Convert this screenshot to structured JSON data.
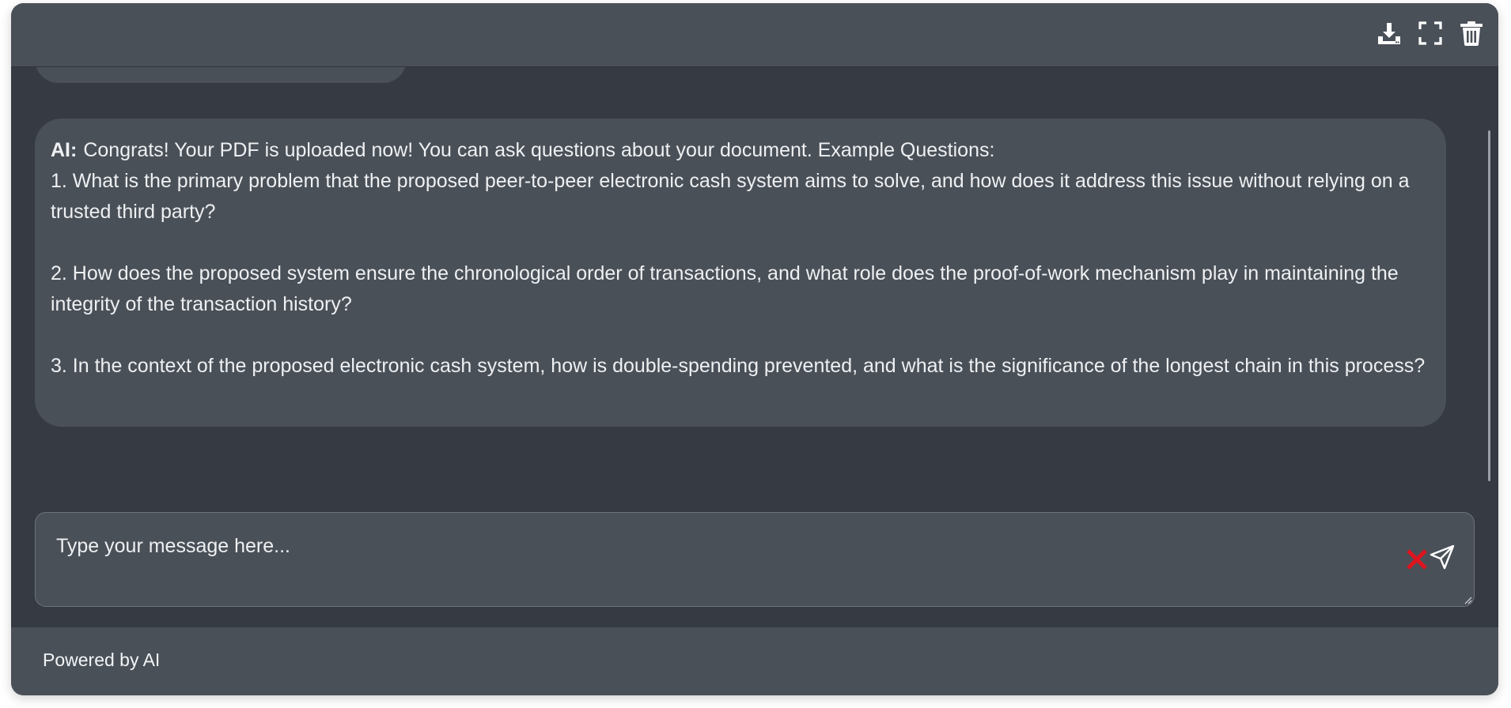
{
  "header": {
    "actions": [
      {
        "icon": "download-icon",
        "label": "Download"
      },
      {
        "icon": "fullscreen-icon",
        "label": "Fullscreen"
      },
      {
        "icon": "trash-icon",
        "label": "Delete"
      }
    ]
  },
  "chat": {
    "ai_message": {
      "sender_label": "AI:",
      "intro": "Congrats! Your PDF is uploaded now! You can ask questions about your document. Example Questions:",
      "questions": [
        "1. What is the primary problem that the proposed peer-to-peer electronic cash system aims to solve, and how does it address this issue without relying on a trusted third party?",
        "2. How does the proposed system ensure the chronological order of transactions, and what role does the proof-of-work mechanism play in maintaining the integrity of the transaction history?",
        "3. In the context of the proposed electronic cash system, how is double-spending prevented, and what is the significance of the longest chain in this process?"
      ]
    }
  },
  "composer": {
    "placeholder": "Type your message here...",
    "value": "",
    "clear_icon": "close-icon",
    "send_icon": "send-icon"
  },
  "footer": {
    "text": "Powered by AI"
  },
  "colors": {
    "panel_bg": "#363a42",
    "bar_bg": "#4a5058",
    "text": "#eef0f2",
    "clear_icon": "#e0141e"
  }
}
